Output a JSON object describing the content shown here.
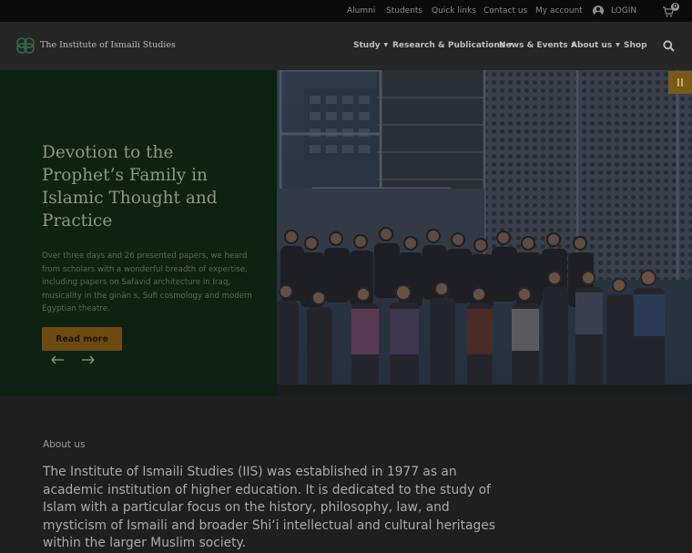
{
  "topbar": {
    "links": [
      "Alumni",
      "Students",
      "Quick links",
      "Contact us",
      "My account"
    ],
    "login_label": "LOGIN",
    "cart_count": "0",
    "icons": [
      "user-circle-icon",
      "cart-icon"
    ]
  },
  "header": {
    "logo_text": "The Institute of Ismaili Studies",
    "nav": [
      {
        "label": "Study",
        "has_dropdown": true
      },
      {
        "label": "Research & Publications",
        "has_dropdown": true
      },
      {
        "label": "News & Events",
        "has_dropdown": true
      },
      {
        "label": "About us",
        "has_dropdown": true
      },
      {
        "label": "Shop",
        "has_dropdown": false
      }
    ],
    "dropdown_caret": "▼",
    "search_icon": "search-icon"
  },
  "hero": {
    "title": "Devotion to the Prophet’s Family in Islamic Thought and Practice",
    "description": "Over three days and 26 presented papers, we heard from scholars with a wonderful breadth of expertise, including papers on Safavid architecture in Iraq, musicality in the ginān s, Sufi cosmology and modern Egyptian theatre.",
    "button_label": "Read more",
    "prev_icon": "arrow-left-icon",
    "next_icon": "arrow-right-icon",
    "pause_icon": "pause-icon",
    "image_subject": "group-photo",
    "colors": {
      "panel": "#0d2210",
      "button": "#6e4b12",
      "pause": "#7a5a17"
    }
  },
  "about": {
    "label": "About us",
    "body": "The Institute of Ismaili Studies (IIS) was established in 1977 as an academic institution of higher education. It is dedicated to the study of Islam with a particular focus on the history, philosophy, law, and mysticism of Ismaili and broader Shi‘i intellectual and cultural heritages within the larger Muslim society."
  }
}
